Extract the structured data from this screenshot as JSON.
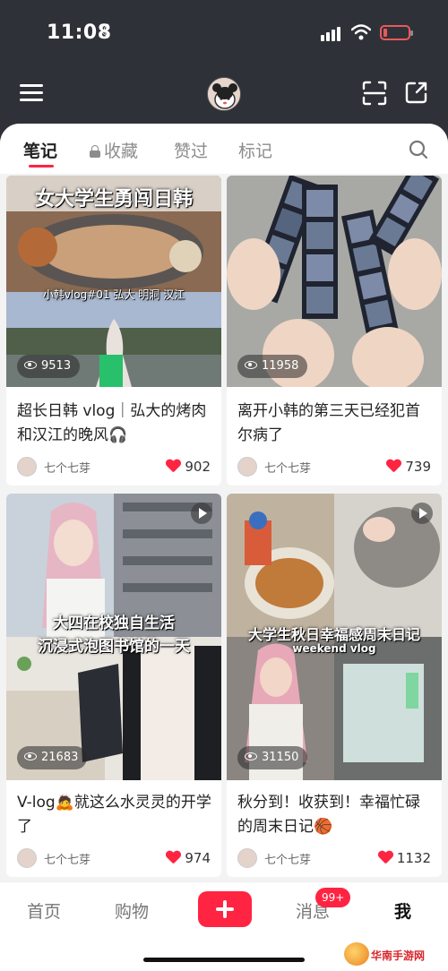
{
  "status_bar": {
    "time": "11:08"
  },
  "tabs": [
    {
      "label": "笔记",
      "active": true
    },
    {
      "label": "收藏",
      "locked": true
    },
    {
      "label": "赞过"
    },
    {
      "label": "标记"
    }
  ],
  "notes": [
    {
      "overlay_title": "女大学生勇闯日韩",
      "overlay_subtitle": "小韩vlog#01 弘大 明洞 汉江",
      "views": "9513",
      "caption": "超长日韩 vlog｜弘大的烤肉和汉江的晚风🎧",
      "author": "七个七芽",
      "likes": "902"
    },
    {
      "views": "11958",
      "caption": "离开小韩的第三天已经犯首尔病了",
      "author": "七个七芽",
      "likes": "739"
    },
    {
      "overlay_title": "大四在校独自生活",
      "overlay_subtitle": "沉浸式泡图书馆的一天",
      "views": "21683",
      "caption": "V-log🙇就这么水灵灵的开学了",
      "author": "七个七芽",
      "likes": "974"
    },
    {
      "overlay_title": "大学生秋日幸福感周末日记",
      "overlay_subtitle": "weekend vlog",
      "views": "31150",
      "caption": "秋分到！收获到！幸福忙碌的周末日记🏀",
      "author": "七个七芽",
      "likes": "1132"
    }
  ],
  "bottom_nav": {
    "home": "首页",
    "shop": "购物",
    "messages": "消息",
    "messages_badge": "99+",
    "me": "我"
  },
  "watermark": "华南手游网",
  "colors": {
    "accent": "#ff2442",
    "header_bg": "#2f3138"
  }
}
